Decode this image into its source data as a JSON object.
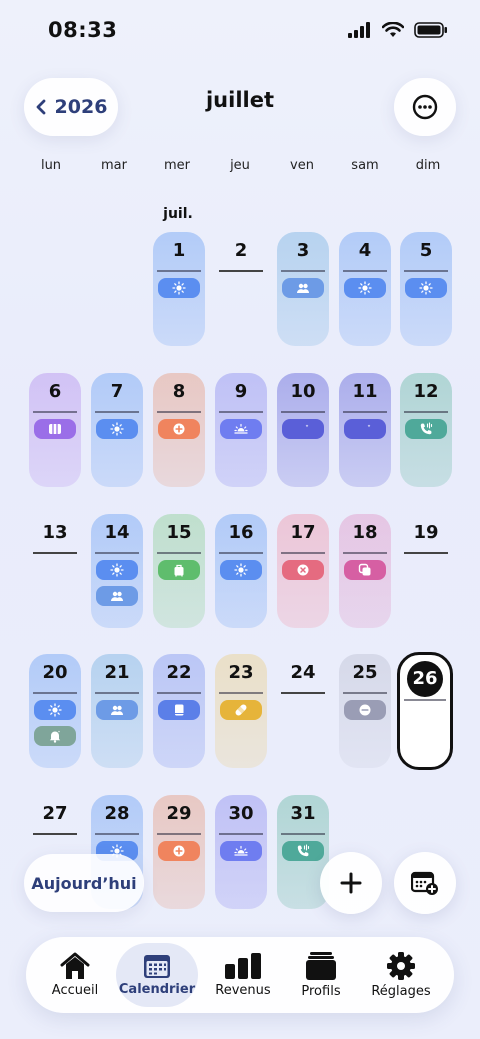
{
  "status": {
    "time": "08:33"
  },
  "header": {
    "back_label": "2026",
    "title": "juillet"
  },
  "weekdays": [
    "lun",
    "mar",
    "mer",
    "jeu",
    "ven",
    "sam",
    "dim"
  ],
  "month_label": "juil.",
  "colors": {
    "sun": "#5b8ef0",
    "people": "#6d9be6",
    "sunrise": "#6f7df0",
    "moon": "#5a5fd8",
    "phone": "#4fa99a",
    "plus": "#f0845e",
    "columns": "#9a6ee8",
    "bag": "#5fbd6d",
    "cancel": "#e56b80",
    "copy": "#d65fa3",
    "bell": "#7fa59a",
    "book": "#5b7fe8",
    "bandage": "#e6b43a",
    "minus": "#9a9db5",
    "today_border": "#111111"
  },
  "days": [
    {
      "n": "1"
    },
    {
      "n": "2"
    },
    {
      "n": "3"
    },
    {
      "n": "4"
    },
    {
      "n": "5"
    },
    {
      "n": "6"
    },
    {
      "n": "7"
    },
    {
      "n": "8"
    },
    {
      "n": "9"
    },
    {
      "n": "10"
    },
    {
      "n": "11"
    },
    {
      "n": "12"
    },
    {
      "n": "13"
    },
    {
      "n": "14"
    },
    {
      "n": "15"
    },
    {
      "n": "16"
    },
    {
      "n": "17"
    },
    {
      "n": "18"
    },
    {
      "n": "19"
    },
    {
      "n": "20"
    },
    {
      "n": "21"
    },
    {
      "n": "22"
    },
    {
      "n": "23"
    },
    {
      "n": "24"
    },
    {
      "n": "25"
    },
    {
      "n": "26"
    },
    {
      "n": "27"
    },
    {
      "n": "28"
    },
    {
      "n": "29"
    },
    {
      "n": "30"
    },
    {
      "n": "31"
    }
  ],
  "today_button": "Aujourd’hui",
  "tabs": [
    {
      "label": "Accueil",
      "icon": "home-icon"
    },
    {
      "label": "Calendrier",
      "icon": "calendar-icon"
    },
    {
      "label": "Revenus",
      "icon": "bar-chart-icon"
    },
    {
      "label": "Profils",
      "icon": "folder-icon"
    },
    {
      "label": "Réglages",
      "icon": "gear-icon"
    }
  ]
}
